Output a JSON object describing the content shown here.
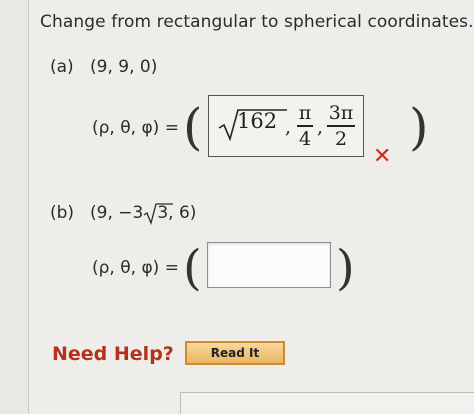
{
  "problem": {
    "title": "Change from rectangular to spherical coordinates."
  },
  "part_a": {
    "label": "(a)",
    "point": "(9, 9, 0)",
    "lhs": "(ρ, θ, φ) =",
    "answer": {
      "sqrt_radicand": "162",
      "theta_num": "π",
      "theta_den": "4",
      "phi_num": "3π",
      "phi_den": "2"
    },
    "status_icon": "wrong-x-icon"
  },
  "part_b": {
    "label": "(b)",
    "point_prefix": "(9, −3",
    "point_radicand": "3",
    "point_suffix": ", 6)",
    "lhs": "(ρ, θ, φ) =",
    "answer_value": ""
  },
  "help": {
    "need_help_label": "Need Help?",
    "read_it_label": "Read It"
  },
  "colors": {
    "wrong": "#d6281f",
    "help_text": "#b5311d",
    "button_border": "#d08a2a"
  }
}
